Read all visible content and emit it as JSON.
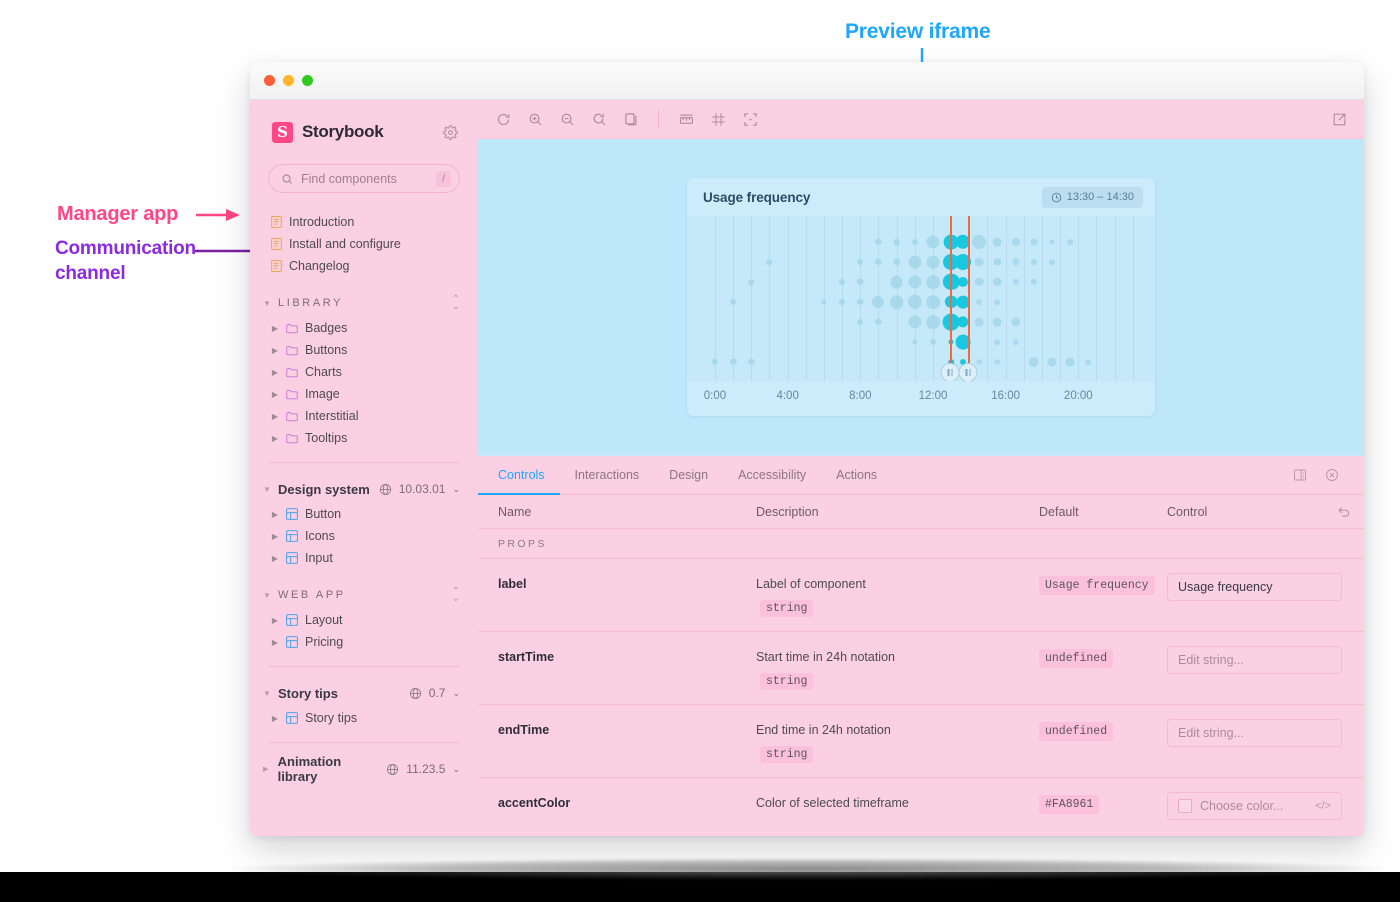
{
  "annotations": {
    "preview": "Preview iframe",
    "manager": "Manager app",
    "channel_line1": "Communication",
    "channel_line2": "channel",
    "colors": {
      "preview": "#1ea7fd",
      "manager": "#ff4785",
      "channel": "#8a2be2"
    }
  },
  "window": {
    "traffic_lights": [
      "close-red",
      "minimize-amber",
      "maximize-green"
    ]
  },
  "sidebar": {
    "brand": "Storybook",
    "logo_glyph": "S",
    "gear_icon": "gear-icon",
    "search": {
      "placeholder": "Find components",
      "shortcut": "/"
    },
    "docs": [
      {
        "label": "Introduction",
        "icon": "document-icon"
      },
      {
        "label": "Install and configure",
        "icon": "document-icon"
      },
      {
        "label": "Changelog",
        "icon": "document-icon"
      }
    ],
    "sections": [
      {
        "title": "LIBRARY",
        "style": "caps",
        "items": [
          {
            "label": "Badges",
            "icon": "folder-icon"
          },
          {
            "label": "Buttons",
            "icon": "folder-icon"
          },
          {
            "label": "Charts",
            "icon": "folder-icon"
          },
          {
            "label": "Image",
            "icon": "folder-icon"
          },
          {
            "label": "Interstitial",
            "icon": "folder-icon"
          },
          {
            "label": "Tooltips",
            "icon": "folder-icon"
          }
        ]
      },
      {
        "title": "Design system",
        "style": "bold",
        "version": "10.03.01",
        "items": [
          {
            "label": "Button",
            "icon": "component-icon"
          },
          {
            "label": "Icons",
            "icon": "component-icon"
          },
          {
            "label": "Input",
            "icon": "component-icon"
          }
        ]
      },
      {
        "title": "WEB APP",
        "style": "caps",
        "items": [
          {
            "label": "Layout",
            "icon": "component-icon"
          },
          {
            "label": "Pricing",
            "icon": "component-icon"
          }
        ]
      },
      {
        "title": "Story tips",
        "style": "bold",
        "version": "0.7",
        "items": [
          {
            "label": "Story tips",
            "icon": "component-icon"
          }
        ]
      },
      {
        "title": "Animation library",
        "style": "bold",
        "version": "11.23.5",
        "collapsed": true,
        "items": []
      }
    ]
  },
  "toolbar": {
    "icons": [
      "refresh-icon",
      "zoom-in-icon",
      "zoom-out-icon",
      "zoom-reset-icon",
      "copy-icon",
      "measure-icon",
      "grid-icon",
      "outline-icon"
    ],
    "open_new_tab_icon": "open-in-new-icon"
  },
  "panel": {
    "tabs": [
      {
        "label": "Controls",
        "active": true
      },
      {
        "label": "Interactions",
        "active": false
      },
      {
        "label": "Design",
        "active": false
      },
      {
        "label": "Accessibility",
        "active": false
      },
      {
        "label": "Actions",
        "active": false
      }
    ],
    "icons": [
      "panel-position-icon",
      "close-circle-icon"
    ],
    "table_headers": {
      "name": "Name",
      "description": "Description",
      "default": "Default",
      "control": "Control",
      "reset_icon": "undo-icon"
    },
    "group_label": "PROPS",
    "rows": [
      {
        "name": "label",
        "description": "Label of component",
        "type": "string",
        "default": "Usage frequency",
        "control_kind": "text",
        "control_value": "Usage frequency",
        "control_placeholder": ""
      },
      {
        "name": "startTime",
        "description": "Start time in 24h notation",
        "type": "string",
        "default": "undefined",
        "control_kind": "text",
        "control_value": "",
        "control_placeholder": "Edit string..."
      },
      {
        "name": "endTime",
        "description": "End time in 24h notation",
        "type": "string",
        "default": "undefined",
        "control_kind": "text",
        "control_value": "",
        "control_placeholder": "Edit string..."
      },
      {
        "name": "accentColor",
        "description": "Color of selected timeframe",
        "type": "",
        "default": "#FA8961",
        "control_kind": "color",
        "control_value": "",
        "control_placeholder": "Choose color..."
      }
    ]
  },
  "chart_data": {
    "type": "scatter",
    "title": "Usage frequency",
    "badge": "13:30 – 14:30",
    "badge_icon": "clock-icon",
    "xlabel": "",
    "ylabel": "",
    "xlim": [
      0,
      24
    ],
    "tick_labels": [
      "0:00",
      "4:00",
      "8:00",
      "12:00",
      "16:00",
      "20:00"
    ],
    "tick_values": [
      0,
      4,
      8,
      12,
      16,
      20
    ],
    "grid": true,
    "legend": "none",
    "selection": {
      "start": 13.5,
      "end": 14.5,
      "accent_color": "#ef6a42"
    },
    "colors": {
      "base": "#9ed2e8",
      "highlight": "#18c8e0",
      "card": "#cdecfb",
      "plot": "#c6e9fa"
    },
    "points": [
      {
        "x": 0.55,
        "row": 6,
        "r": 3.2,
        "hl": false
      },
      {
        "x": 1.55,
        "row": 6,
        "r": 3.2,
        "hl": false
      },
      {
        "x": 2.55,
        "row": 6,
        "r": 3.2,
        "hl": false
      },
      {
        "x": 1.55,
        "row": 3,
        "r": 3.0,
        "hl": false
      },
      {
        "x": 2.55,
        "row": 2,
        "r": 2.8,
        "hl": false
      },
      {
        "x": 3.55,
        "row": 1,
        "r": 2.8,
        "hl": false
      },
      {
        "x": 6.55,
        "row": 3,
        "r": 2.6,
        "hl": false
      },
      {
        "x": 7.55,
        "row": 2,
        "r": 3.0,
        "hl": false
      },
      {
        "x": 7.55,
        "row": 3,
        "r": 3.0,
        "hl": false
      },
      {
        "x": 8.55,
        "row": 1,
        "r": 3.0,
        "hl": false
      },
      {
        "x": 8.55,
        "row": 2,
        "r": 3.2,
        "hl": false
      },
      {
        "x": 8.55,
        "row": 3,
        "r": 3.2,
        "hl": false
      },
      {
        "x": 8.55,
        "row": 4,
        "r": 3.0,
        "hl": false
      },
      {
        "x": 9.55,
        "row": 0,
        "r": 3.2,
        "hl": false
      },
      {
        "x": 9.55,
        "row": 1,
        "r": 3.2,
        "hl": false
      },
      {
        "x": 9.55,
        "row": 3,
        "r": 6.0,
        "hl": false
      },
      {
        "x": 9.55,
        "row": 4,
        "r": 3.2,
        "hl": false
      },
      {
        "x": 10.55,
        "row": 0,
        "r": 3.4,
        "hl": false
      },
      {
        "x": 10.55,
        "row": 1,
        "r": 3.6,
        "hl": false
      },
      {
        "x": 10.55,
        "row": 2,
        "r": 6.4,
        "hl": false
      },
      {
        "x": 10.55,
        "row": 3,
        "r": 6.8,
        "hl": false
      },
      {
        "x": 11.55,
        "row": 0,
        "r": 3.0,
        "hl": false
      },
      {
        "x": 11.55,
        "row": 1,
        "r": 6.4,
        "hl": false
      },
      {
        "x": 11.55,
        "row": 2,
        "r": 6.6,
        "hl": false
      },
      {
        "x": 11.55,
        "row": 3,
        "r": 7.2,
        "hl": false
      },
      {
        "x": 11.55,
        "row": 4,
        "r": 6.6,
        "hl": false
      },
      {
        "x": 11.55,
        "row": 5,
        "r": 2.6,
        "hl": false
      },
      {
        "x": 12.55,
        "row": 0,
        "r": 6.6,
        "hl": false
      },
      {
        "x": 12.55,
        "row": 1,
        "r": 6.4,
        "hl": false
      },
      {
        "x": 12.55,
        "row": 2,
        "r": 6.8,
        "hl": false
      },
      {
        "x": 12.55,
        "row": 3,
        "r": 6.8,
        "hl": false
      },
      {
        "x": 12.55,
        "row": 4,
        "r": 7.0,
        "hl": false
      },
      {
        "x": 12.55,
        "row": 5,
        "r": 3.0,
        "hl": false
      },
      {
        "x": 13.55,
        "row": 0,
        "r": 7.4,
        "hl": true
      },
      {
        "x": 13.55,
        "row": 1,
        "r": 8.0,
        "hl": true
      },
      {
        "x": 13.55,
        "row": 2,
        "r": 8.2,
        "hl": true
      },
      {
        "x": 13.55,
        "row": 3,
        "r": 6.2,
        "hl": true
      },
      {
        "x": 13.55,
        "row": 4,
        "r": 8.4,
        "hl": true
      },
      {
        "x": 13.55,
        "row": 5,
        "r": 2.6,
        "hl": true
      },
      {
        "x": 13.55,
        "row": 6,
        "r": 2.8,
        "hl": true
      },
      {
        "x": 14.2,
        "row": 0,
        "r": 7.2,
        "hl": true
      },
      {
        "x": 14.2,
        "row": 1,
        "r": 8.0,
        "hl": true
      },
      {
        "x": 14.2,
        "row": 2,
        "r": 5.0,
        "hl": true
      },
      {
        "x": 14.2,
        "row": 3,
        "r": 6.4,
        "hl": true
      },
      {
        "x": 14.2,
        "row": 4,
        "r": 5.6,
        "hl": true
      },
      {
        "x": 14.2,
        "row": 5,
        "r": 7.4,
        "hl": true
      },
      {
        "x": 14.2,
        "row": 6,
        "r": 3.0,
        "hl": true
      },
      {
        "x": 15.1,
        "row": 0,
        "r": 7.0,
        "hl": false
      },
      {
        "x": 15.1,
        "row": 1,
        "r": 4.4,
        "hl": false
      },
      {
        "x": 15.1,
        "row": 2,
        "r": 4.2,
        "hl": false
      },
      {
        "x": 15.1,
        "row": 3,
        "r": 3.0,
        "hl": false
      },
      {
        "x": 15.1,
        "row": 4,
        "r": 4.4,
        "hl": false
      },
      {
        "x": 15.1,
        "row": 6,
        "r": 2.6,
        "hl": false
      },
      {
        "x": 16.1,
        "row": 0,
        "r": 4.4,
        "hl": false
      },
      {
        "x": 16.1,
        "row": 1,
        "r": 3.6,
        "hl": false
      },
      {
        "x": 16.1,
        "row": 2,
        "r": 4.2,
        "hl": false
      },
      {
        "x": 16.1,
        "row": 3,
        "r": 2.8,
        "hl": false
      },
      {
        "x": 16.1,
        "row": 4,
        "r": 4.4,
        "hl": false
      },
      {
        "x": 16.1,
        "row": 5,
        "r": 2.8,
        "hl": false
      },
      {
        "x": 16.1,
        "row": 6,
        "r": 2.6,
        "hl": false
      },
      {
        "x": 17.1,
        "row": 0,
        "r": 4.0,
        "hl": false
      },
      {
        "x": 17.1,
        "row": 1,
        "r": 3.6,
        "hl": false
      },
      {
        "x": 17.1,
        "row": 2,
        "r": 3.2,
        "hl": false
      },
      {
        "x": 17.1,
        "row": 4,
        "r": 4.6,
        "hl": false
      },
      {
        "x": 17.1,
        "row": 5,
        "r": 2.8,
        "hl": false
      },
      {
        "x": 18.1,
        "row": 0,
        "r": 3.4,
        "hl": false
      },
      {
        "x": 18.1,
        "row": 1,
        "r": 3.0,
        "hl": false
      },
      {
        "x": 18.1,
        "row": 2,
        "r": 3.2,
        "hl": false
      },
      {
        "x": 18.1,
        "row": 6,
        "r": 4.8,
        "hl": false
      },
      {
        "x": 19.1,
        "row": 0,
        "r": 2.6,
        "hl": false
      },
      {
        "x": 19.1,
        "row": 1,
        "r": 2.8,
        "hl": false
      },
      {
        "x": 19.1,
        "row": 6,
        "r": 4.6,
        "hl": false
      },
      {
        "x": 20.1,
        "row": 0,
        "r": 2.8,
        "hl": false
      },
      {
        "x": 20.1,
        "row": 6,
        "r": 4.4,
        "hl": false
      },
      {
        "x": 21.1,
        "row": 6,
        "r": 2.8,
        "hl": false
      }
    ]
  }
}
